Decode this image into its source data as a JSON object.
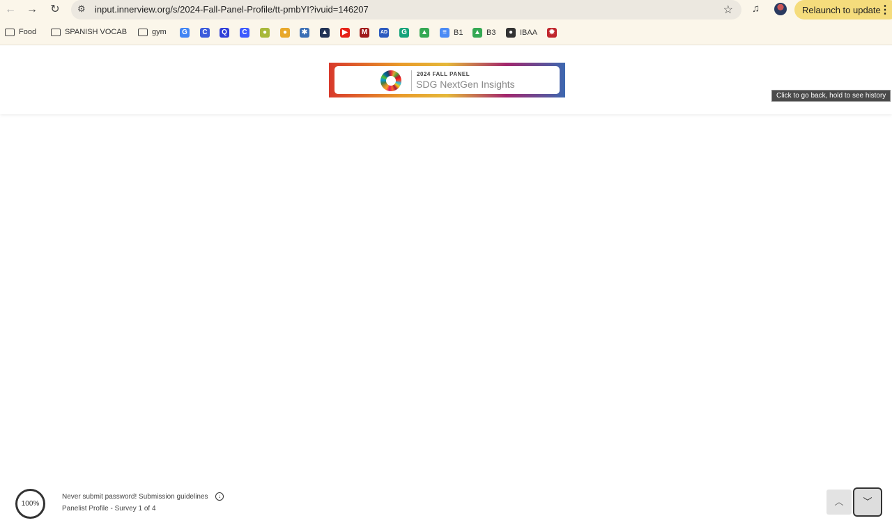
{
  "browser": {
    "url": "input.innerview.org/s/2024-Fall-Panel-Profile/tt-pmbYI?ivuid=146207",
    "relaunch_label": "Relaunch to update",
    "tooltip": "Click to go back, hold to see history"
  },
  "bookmarks": [
    {
      "label": "Food",
      "icon": "folder-icon"
    },
    {
      "label": "SPANISH VOCAB",
      "icon": "folder-icon"
    },
    {
      "label": "gym",
      "icon": "folder-icon"
    },
    {
      "label": "",
      "icon": "google-icon",
      "glyph": "G",
      "color": "#4285f4"
    },
    {
      "label": "",
      "icon": "c-circle-icon",
      "glyph": "C",
      "color": "#3b5bdb"
    },
    {
      "label": "",
      "icon": "q-icon",
      "glyph": "Q",
      "color": "#2f3fd8"
    },
    {
      "label": "",
      "icon": "c-square-icon",
      "glyph": "C",
      "color": "#3d5afe"
    },
    {
      "label": "",
      "icon": "pear-icon",
      "glyph": "●",
      "color": "#a8b83a"
    },
    {
      "label": "",
      "icon": "puzzle-icon",
      "glyph": "●",
      "color": "#e8a82a"
    },
    {
      "label": "",
      "icon": "figure-icon",
      "glyph": "✱",
      "color": "#3b6fb5"
    },
    {
      "label": "",
      "icon": "graduation-cap-icon",
      "glyph": "▲",
      "color": "#223355"
    },
    {
      "label": "",
      "icon": "youtube-icon",
      "glyph": "▶",
      "color": "#e62117"
    },
    {
      "label": "",
      "icon": "m-icon",
      "glyph": "M",
      "color": "#a01a1a"
    },
    {
      "label": "",
      "icon": "ad-icon",
      "glyph": "AD",
      "color": "#2d5bbf"
    },
    {
      "label": "",
      "icon": "grammarly-icon",
      "glyph": "G",
      "color": "#15a37a"
    },
    {
      "label": "",
      "icon": "drive-icon",
      "glyph": "▲",
      "color": "#34a853"
    },
    {
      "label": "B1",
      "icon": "docs-icon",
      "glyph": "≡",
      "color": "#4b8bf5"
    },
    {
      "label": "B3",
      "icon": "drive-icon",
      "glyph": "▲",
      "color": "#34a853"
    },
    {
      "label": "IBAA",
      "icon": "globe-icon",
      "glyph": "●",
      "color": "#333333"
    },
    {
      "label": "",
      "icon": "gear-red-icon",
      "glyph": "✹",
      "color": "#c0262d"
    }
  ],
  "logo": {
    "line1": "2024 FALL PANEL",
    "line2": "SDG NextGen Insights"
  },
  "footer": {
    "progress": "100%",
    "notice": "Never submit password! Submission guidelines",
    "survey": "Panelist Profile - Survey 1 of 4"
  }
}
